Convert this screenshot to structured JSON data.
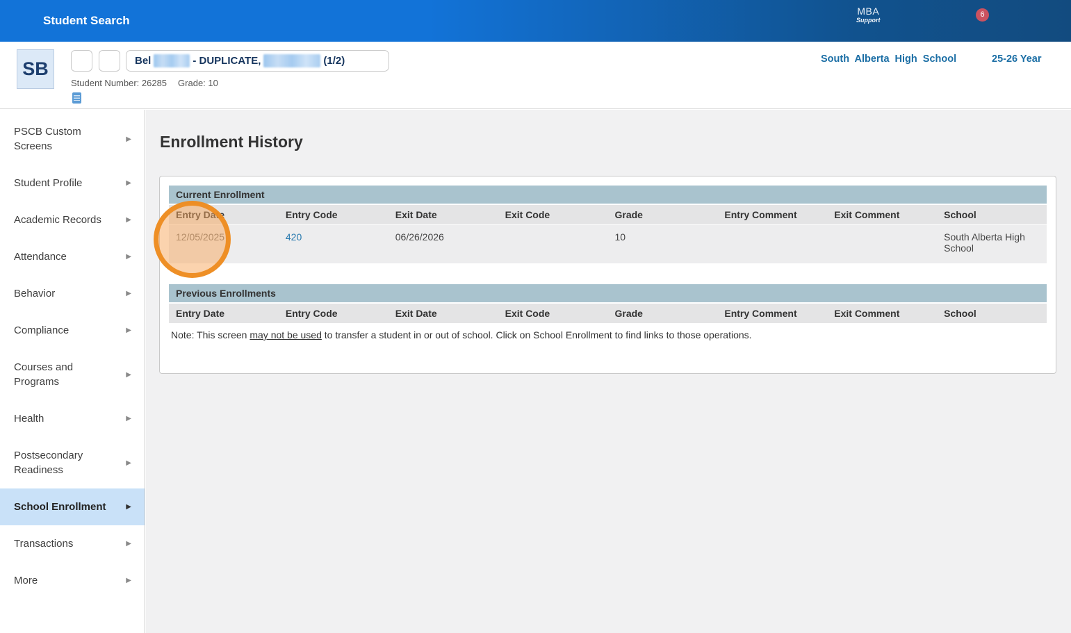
{
  "header": {
    "title": "Student Search",
    "logo_line1": "MBA",
    "logo_line2": "Support",
    "badge_count": "6"
  },
  "student_bar": {
    "avatar_initials": "SB",
    "name_prefix": "Bel",
    "name_middle": "- DUPLICATE,",
    "name_suffix": "(1/2)",
    "student_number": "Student Number: 26285",
    "grade": "Grade: 10",
    "school_name": "South Alberta High School",
    "term": "25-26 Year"
  },
  "sidebar": {
    "items": [
      {
        "label": "PSCB Custom Screens",
        "selected": false
      },
      {
        "label": "Student Profile",
        "selected": false
      },
      {
        "label": "Academic Records",
        "selected": false
      },
      {
        "label": "Attendance",
        "selected": false
      },
      {
        "label": "Behavior",
        "selected": false
      },
      {
        "label": "Compliance",
        "selected": false
      },
      {
        "label": "Courses and Programs",
        "selected": false
      },
      {
        "label": "Health",
        "selected": false
      },
      {
        "label": "Postsecondary Readiness",
        "selected": false
      },
      {
        "label": "School Enrollment",
        "selected": true
      },
      {
        "label": "Transactions",
        "selected": false
      },
      {
        "label": "More",
        "selected": false
      }
    ]
  },
  "main": {
    "title": "Enrollment History",
    "columns": [
      "Entry Date",
      "Entry Code",
      "Exit Date",
      "Exit Code",
      "Grade",
      "Entry Comment",
      "Exit Comment",
      "School"
    ],
    "current": {
      "section_title": "Current Enrollment",
      "row": {
        "entry_date": "12/05/2025",
        "entry_code": "420",
        "exit_date": "06/26/2026",
        "exit_code": "",
        "grade": "10",
        "entry_comment": "",
        "exit_comment": "",
        "school": "South Alberta High School"
      }
    },
    "previous": {
      "section_title": "Previous Enrollments"
    },
    "note": {
      "prefix": "Note: This screen ",
      "underlined": "may not be used",
      "suffix": " to transfer a student in or out of school. Click on School Enrollment to find links to those operations."
    }
  },
  "colors": {
    "header_blue": "#1273d8",
    "header_dark_blue": "#124b7f",
    "badge_red": "#cb5260",
    "section_header_bg": "#a9c3ce",
    "selected_nav_bg": "#c9e1f8",
    "link_blue": "#2779ae",
    "school_label_blue": "#1b6ea5",
    "highlight_orange": "#ee8c1f"
  }
}
